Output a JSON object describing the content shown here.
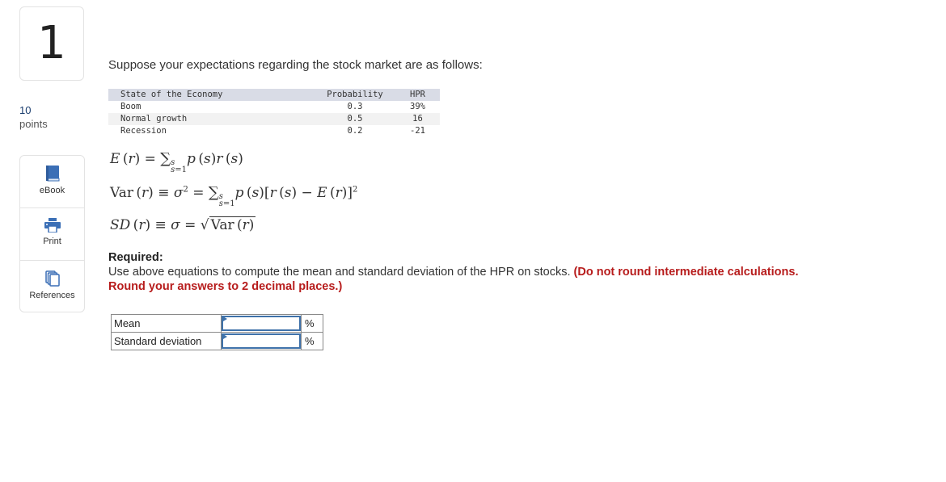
{
  "question": {
    "number": "1",
    "points_value": "10",
    "points_label": "points"
  },
  "tools": [
    {
      "label": "eBook",
      "icon": "book-icon"
    },
    {
      "label": "Print",
      "icon": "printer-icon"
    },
    {
      "label": "References",
      "icon": "documents-icon"
    }
  ],
  "intro": "Suppose your expectations regarding the stock market are as follows:",
  "data_table": {
    "headers": [
      "State of the Economy",
      "Probability",
      "HPR"
    ],
    "rows": [
      [
        "Boom",
        "0.3",
        "39%"
      ],
      [
        "Normal growth",
        "0.5",
        "16"
      ],
      [
        "Recession",
        "0.2",
        "-21"
      ]
    ]
  },
  "equations": {
    "mean": "E(r) = Σ_{s=1}^{S} p(s) r(s)",
    "variance": "Var(r) ≡ σ² = Σ_{s=1}^{S} p(s)[r(s) − E(r)]²",
    "sd": "SD(r) ≡ σ = √Var(r)"
  },
  "required": {
    "heading": "Required:",
    "text": "Use above equations to compute the mean and standard deviation of the HPR on stocks.",
    "note_line1": "(Do not round intermediate calculations.",
    "note_line2": "Round your answers to 2 decimal places.)"
  },
  "answers": [
    {
      "label": "Mean",
      "value": "",
      "unit": "%"
    },
    {
      "label": "Standard deviation",
      "value": "",
      "unit": "%"
    }
  ]
}
